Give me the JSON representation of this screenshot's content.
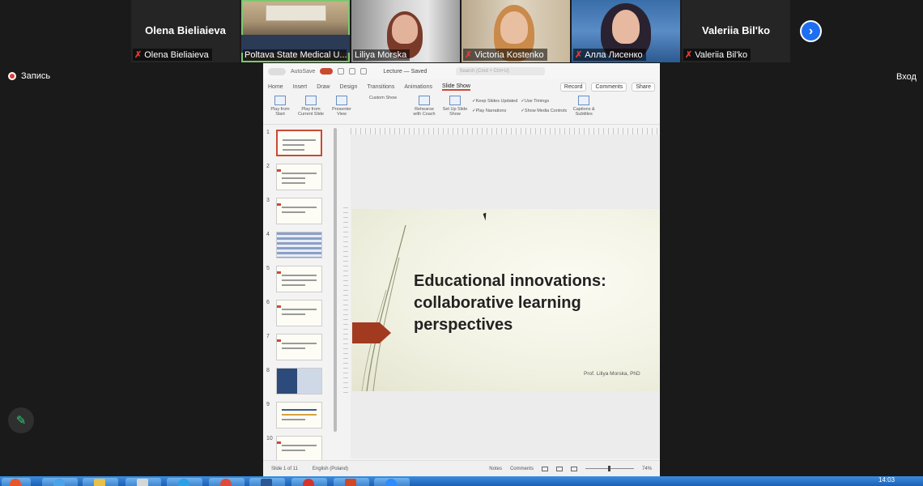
{
  "participants": [
    {
      "name": "Olena Bieliaieva",
      "video": false,
      "muted": true
    },
    {
      "name": "Poltava State Medical U...",
      "video": true,
      "muted": false,
      "active": true
    },
    {
      "name": "Liliya Morska",
      "video": true,
      "muted": false
    },
    {
      "name": "Victoria Kostenko",
      "video": true,
      "muted": true
    },
    {
      "name": "Алла Лисенко",
      "video": true,
      "muted": true
    },
    {
      "name": "Valeriia Bil'ko",
      "video": false,
      "muted": true
    }
  ],
  "recording_label": "Запись",
  "exit_label": "Вход",
  "ppt": {
    "autosave": "AutoSave",
    "file_title": "Lecture — Saved",
    "search_placeholder": "Search (Cmd + Ctrl+U)",
    "tabs": [
      "Home",
      "Insert",
      "Draw",
      "Design",
      "Transitions",
      "Animations",
      "Slide Show"
    ],
    "selected_tab": "Slide Show",
    "record_label": "Record",
    "comments_label": "Comments",
    "share_label": "Share",
    "ribbon": {
      "play_from_start": "Play from Start",
      "play_from_current": "Play from Current Slide",
      "presenter_view": "Presenter View",
      "custom_show": "Custom Show",
      "rehearse": "Rehearse with Coach",
      "set_up": "Set Up Slide Show",
      "keep_slides": "Keep Slides Updated",
      "use_timings": "Use Timings",
      "play_narrations": "Play Narrations",
      "show_media": "Show Media Controls",
      "captions": "Captions & Subtitles"
    },
    "slide_numbers": [
      "1",
      "2",
      "3",
      "4",
      "5",
      "6",
      "7",
      "8",
      "9",
      "10"
    ],
    "slide": {
      "title_line1": "Educational innovations:",
      "title_line2": "collaborative learning",
      "title_line3": "perspectives",
      "author": "Prof. Liliya Morska, PhD"
    },
    "status": {
      "slide_count": "Slide 1 of 11",
      "language": "English (Poland)",
      "notes": "Notes",
      "comments": "Comments",
      "zoom": "74%"
    }
  },
  "taskbar_time": "14:03",
  "colors": {
    "accent": "#c84b31",
    "zoom_next": "#1e6ef0",
    "active_speaker": "#7bc96f"
  }
}
